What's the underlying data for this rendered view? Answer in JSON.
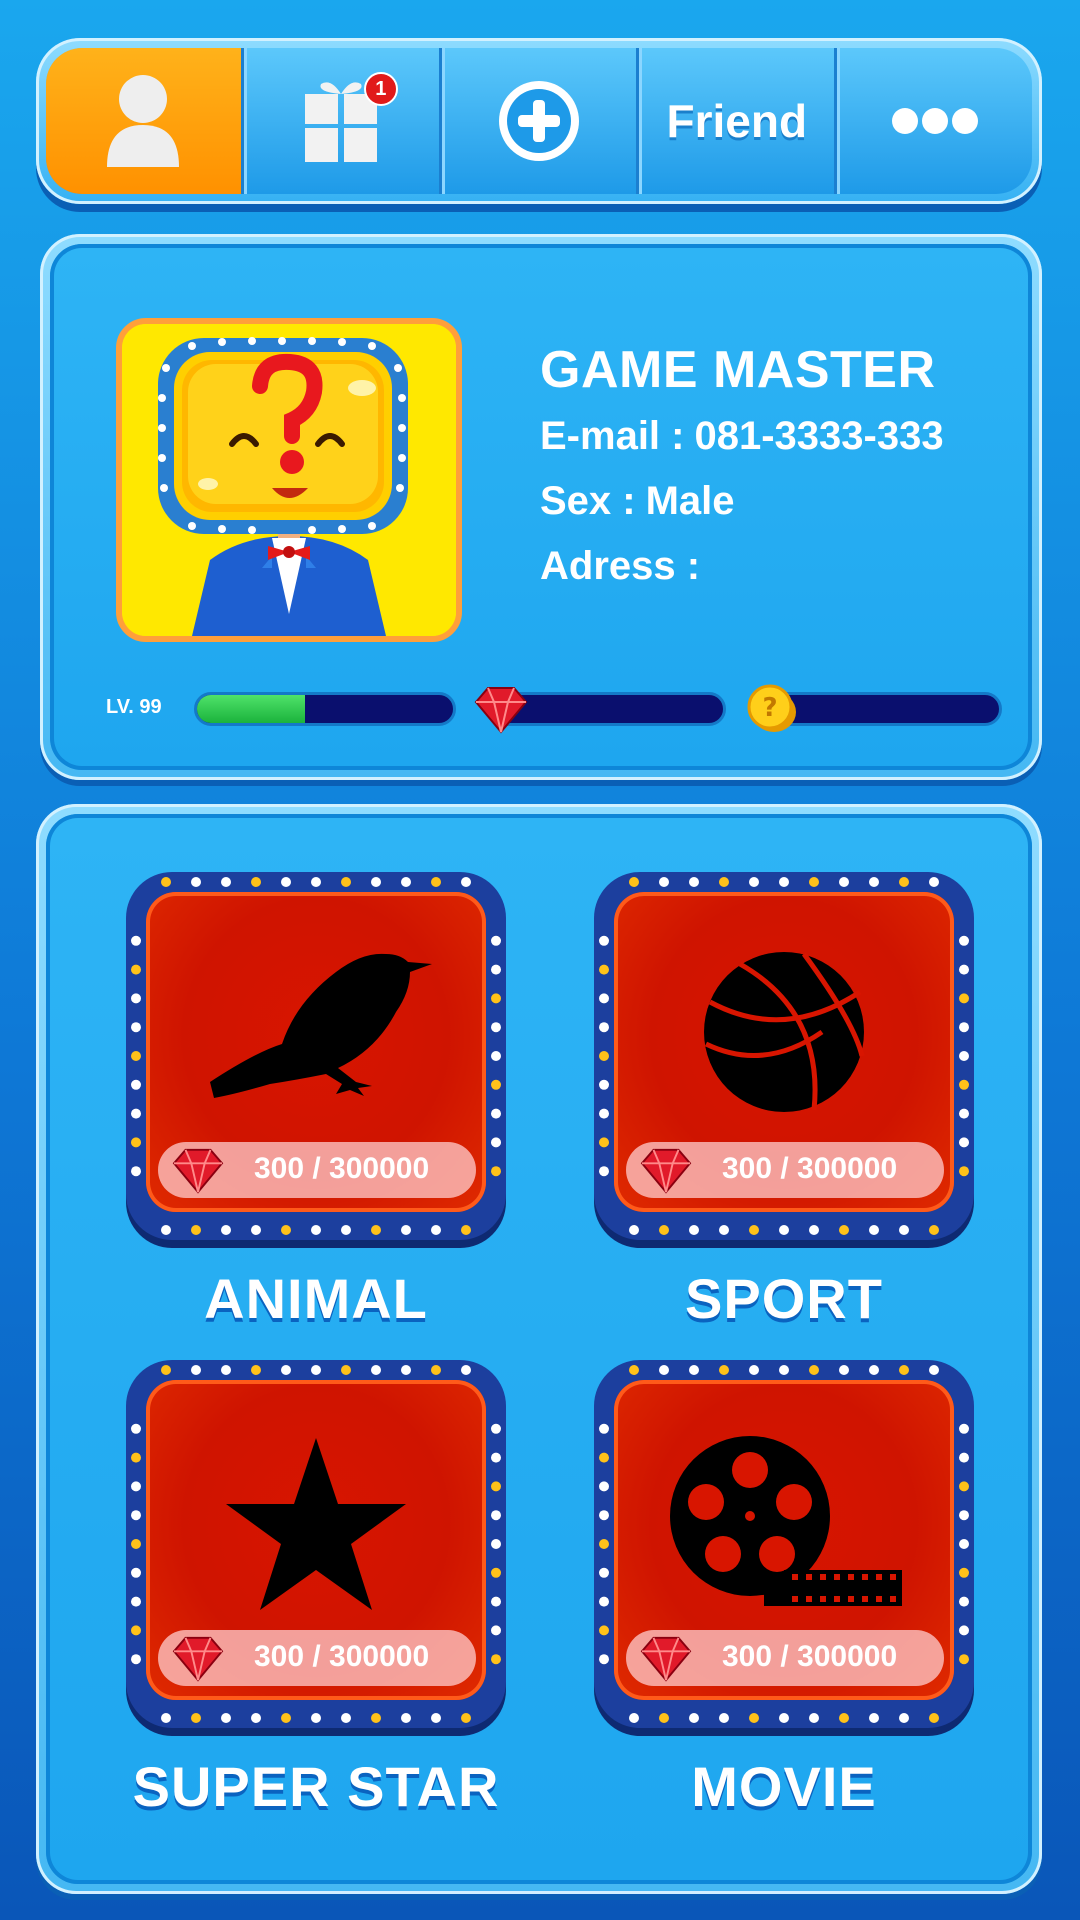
{
  "nav": {
    "tabs": [
      {
        "icon": "profile-icon",
        "active": true
      },
      {
        "icon": "gift-icon",
        "badge": "1"
      },
      {
        "icon": "plus-circle-icon"
      },
      {
        "label": "Friend"
      },
      {
        "icon": "more-dots-icon"
      }
    ]
  },
  "profile": {
    "name": "GAME MASTER",
    "email_label": "E-mail :",
    "email_value": "081-3333-333",
    "sex_label": "Sex :",
    "sex_value": "Male",
    "address_label": "Adress :",
    "address_value": "",
    "level_label": "LV. 99",
    "level_progress": 0.42,
    "gem_progress": 0,
    "coin_progress": 0
  },
  "categories": [
    {
      "name": "ANIMAL",
      "icon": "bird-icon",
      "progress_text": "300 / 300000"
    },
    {
      "name": "SPORT",
      "icon": "basketball-icon",
      "progress_text": "300 / 300000"
    },
    {
      "name": "SUPER STAR",
      "icon": "star-icon",
      "progress_text": "300 / 300000"
    },
    {
      "name": "MOVIE",
      "icon": "film-reel-icon",
      "progress_text": "300 / 300000"
    }
  ],
  "colors": {
    "accent_orange": "#ff9f00",
    "panel_blue": "#1ea6ef",
    "card_red": "#d81500",
    "bar_fill_green": "#1bb33c",
    "bar_track_navy": "#0a0f6e"
  }
}
